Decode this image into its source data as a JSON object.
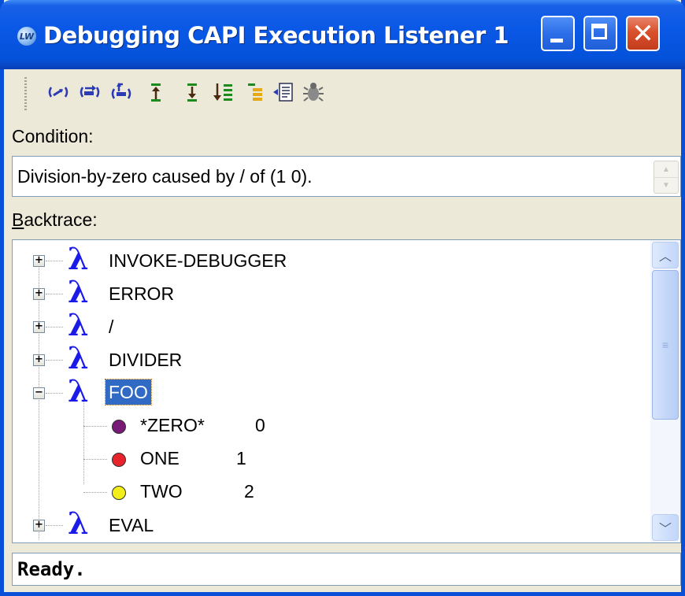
{
  "window": {
    "title": "Debugging CAPI Execution Listener 1",
    "app_icon_text": "LW"
  },
  "toolbar": {
    "tools": [
      {
        "name": "continue-icon"
      },
      {
        "name": "restart-icon"
      },
      {
        "name": "abort-icon"
      },
      {
        "name": "previous-frame-icon"
      },
      {
        "name": "next-frame-icon"
      },
      {
        "name": "bottom-frame-icon"
      },
      {
        "name": "top-frame-icon"
      },
      {
        "name": "find-source-icon"
      },
      {
        "name": "bug-icon"
      }
    ]
  },
  "condition": {
    "label": "Condition:",
    "text": "Division-by-zero caused by / of (1 0)."
  },
  "backtrace": {
    "label_accel": "B",
    "label_rest": "acktrace:",
    "frames": [
      {
        "name": "INVOKE-DEBUGGER",
        "expander": "+"
      },
      {
        "name": "ERROR",
        "expander": "+"
      },
      {
        "name": "/",
        "expander": "+"
      },
      {
        "name": "DIVIDER",
        "expander": "+"
      },
      {
        "name": "FOO",
        "expander": "−",
        "selected": true
      },
      {
        "name": "EVAL",
        "expander": "+"
      }
    ],
    "variables": [
      {
        "name": "*ZERO*",
        "value": "0",
        "color": "#7a1a78"
      },
      {
        "name": "ONE",
        "value": "1",
        "color": "#e8232b"
      },
      {
        "name": "TWO",
        "value": "2",
        "color": "#f2ee1a"
      }
    ],
    "scroll_up_glyph": "︿",
    "scroll_down_glyph": "﹀",
    "thumb_glyph": "≡"
  },
  "status": {
    "text": "Ready."
  },
  "colors": {
    "titlebar": "#0a58e6",
    "lambda": "#1b1be8",
    "selection": "#316ac5"
  }
}
